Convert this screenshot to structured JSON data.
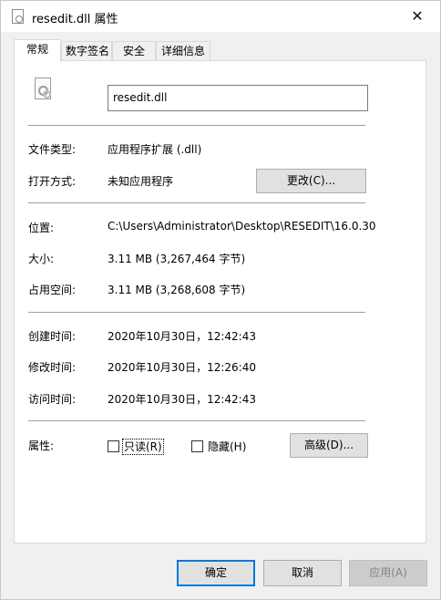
{
  "window": {
    "title": "resedit.dll 属性",
    "close_glyph": "✕"
  },
  "tabs": [
    {
      "label": "常规",
      "active": true
    },
    {
      "label": "数字签名",
      "active": false
    },
    {
      "label": "安全",
      "active": false
    },
    {
      "label": "详细信息",
      "active": false
    }
  ],
  "general": {
    "file_name": "resedit.dll",
    "type_label": "文件类型:",
    "type_value": "应用程序扩展 (.dll)",
    "opens_label": "打开方式:",
    "opens_value": "未知应用程序",
    "change_button": "更改(C)...",
    "location_label": "位置:",
    "location_value": "C:\\Users\\Administrator\\Desktop\\RESEDIT\\16.0.30",
    "size_label": "大小:",
    "size_value": "3.11 MB (3,267,464 字节)",
    "disk_label": "占用空间:",
    "disk_value": "3.11 MB (3,268,608 字节)",
    "created_label": "创建时间:",
    "created_value": "2020年10月30日，12:42:43",
    "modified_label": "修改时间:",
    "modified_value": "2020年10月30日，12:26:40",
    "accessed_label": "访问时间:",
    "accessed_value": "2020年10月30日，12:42:43",
    "attributes_label": "属性:",
    "readonly_label": "只读(R)",
    "readonly_checked": false,
    "hidden_label": "隐藏(H)",
    "hidden_checked": false,
    "advanced_button": "高级(D)..."
  },
  "footer": {
    "ok": "确定",
    "cancel": "取消",
    "apply": "应用(A)"
  }
}
